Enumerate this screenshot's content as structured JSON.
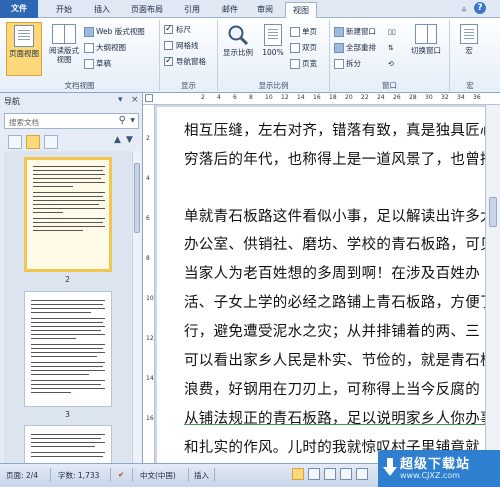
{
  "tabs": [
    "文件",
    "开始",
    "插入",
    "页面布局",
    "引用",
    "邮件",
    "审阅",
    "视图"
  ],
  "active_tab": "视图",
  "ribbon": {
    "doc_views": {
      "label": "文档视图",
      "page_view": "页面视图",
      "reading_view_1": "阅读版式",
      "reading_view_2": "视图",
      "web_layout": "Web 版式视图",
      "outline": "大纲视图",
      "draft": "草稿"
    },
    "show": {
      "label": "显示",
      "ruler": "标尺",
      "gridlines": "网格线",
      "nav_pane": "导航窗格",
      "ruler_checked": true,
      "gridlines_checked": false,
      "nav_pane_checked": true
    },
    "zoom": {
      "label": "显示比例",
      "zoom_btn": "显示比例",
      "hundred": "100%",
      "one_page": "单页",
      "two_pages": "双页",
      "page_width": "页宽"
    },
    "window": {
      "label": "窗口",
      "new_window": "新建窗口",
      "arrange_all": "全部重排",
      "split": "拆分",
      "switch_window": "切换窗口"
    },
    "macros": {
      "label": "宏",
      "macro": "宏"
    }
  },
  "nav": {
    "title": "导航",
    "search_placeholder": "搜索文档",
    "thumb_numbers": [
      "2",
      "3"
    ]
  },
  "document": {
    "lines": [
      "相互压缝，左右对齐，错落有致，真是独具匠心",
      "穷落后的年代，也称得上是一道风景了，也曾招",
      "",
      "单就青石板路这件看似小事，足以解读出许多大",
      "办公室、供销社、磨坊、学校的青石板路，可见",
      "当家人为老百姓想的多周到啊！在涉及百姓办",
      "活、子女上学的必经之路铺上青石板路，方便了",
      "行，避免遭受泥水之灾；从并排铺着的两、三",
      "可以看出家乡人民是朴实、节俭的，就是青石板",
      "浪费，好钢用在刀刃上，可称得上当今反腐的",
      "从铺法规正的青石板路，足以说明家乡人你办事",
      "和扎实的作风。儿时的我就惊叹村子里铺竟就"
    ]
  },
  "status": {
    "page": "页面: 2/4",
    "words": "字数: 1,733",
    "lang": "中文(中国)",
    "mode": "插入"
  },
  "watermark": {
    "title": "超级下载站",
    "url": "www.CJXZ.com"
  },
  "ruler_numbers": [
    "2",
    "4",
    "6",
    "8",
    "10",
    "12",
    "14",
    "16",
    "18",
    "20",
    "22",
    "24",
    "26",
    "28",
    "30",
    "32",
    "34",
    "36"
  ],
  "vruler_numbers": [
    "2",
    "4",
    "6",
    "8",
    "10",
    "12",
    "14",
    "16"
  ]
}
